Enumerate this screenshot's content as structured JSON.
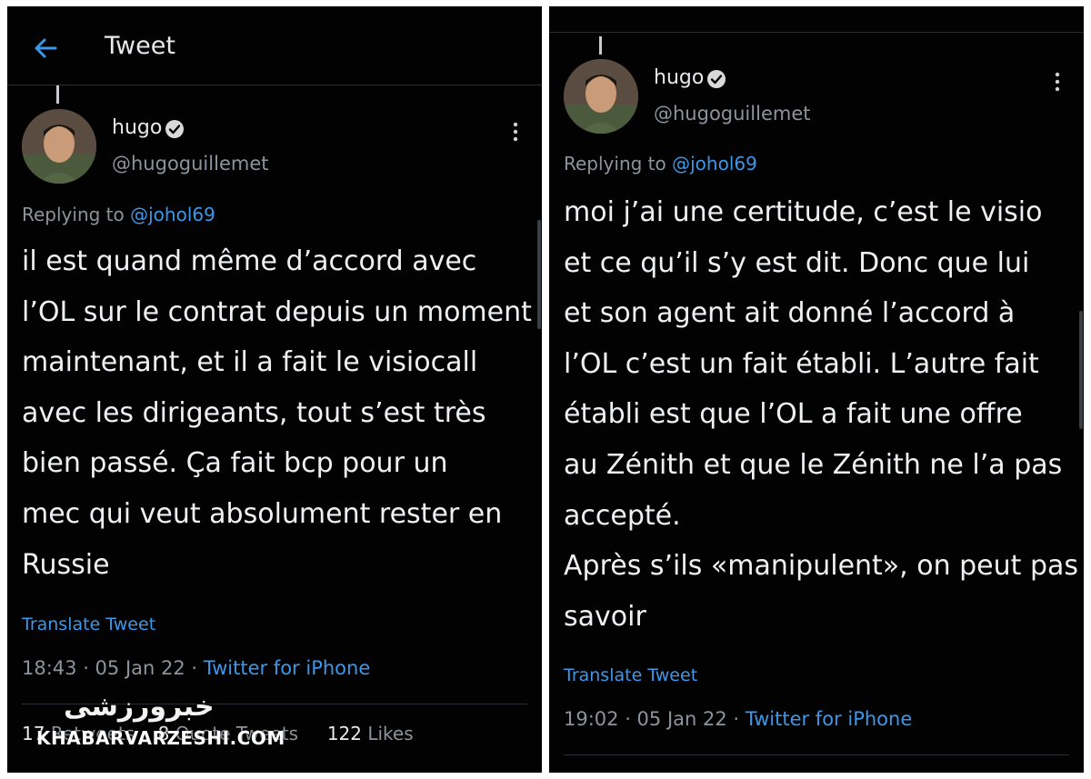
{
  "header": {
    "title": "Tweet"
  },
  "tweets": [
    {
      "user": {
        "name": "hugo",
        "handle": "@hugoguillemet"
      },
      "replying_prefix": "Replying to",
      "replying_to": "@johol69",
      "lines": [
        "il est quand même d’accord avec",
        "l’OL sur le contrat depuis un moment",
        "maintenant, et il a fait le visiocall",
        "avec les dirigeants, tout s’est très",
        "bien passé. Ça fait bcp pour un",
        "mec qui veut absolument rester en",
        "Russie"
      ],
      "translate": "Translate Tweet",
      "time": "18:43 · 05 Jan 22 ·",
      "source": "Twitter for iPhone",
      "stats": {
        "retweets_count": "17",
        "retweets_label": "Retweets",
        "quotes_count": "8",
        "quotes_label": "Quote Tweets",
        "likes_count": "122",
        "likes_label": "Likes"
      }
    },
    {
      "user": {
        "name": "hugo",
        "handle": "@hugoguillemet"
      },
      "replying_prefix": "Replying to",
      "replying_to": "@johol69",
      "lines": [
        "moi j’ai une certitude, c’est le visio",
        "et ce qu’il s’y est dit. Donc que lui",
        "et son agent ait donné l’accord à",
        "l’OL c’est un fait établi. L’autre fait",
        "établi est que l’OL a fait une offre",
        "au Zénith et que le Zénith ne l’a pas",
        "accepté.",
        "Après s’ils «manipulent», on peut pas",
        "savoir"
      ],
      "translate": "Translate Tweet",
      "time": "19:02 · 05 Jan 22 ·",
      "source": "Twitter for iPhone"
    }
  ],
  "watermark": {
    "logo": "خبرورزشی",
    "text": "KHABARVARZESHI.COM"
  },
  "icons": {
    "back": "arrow-left-icon",
    "verified": "verified-badge-icon",
    "more": "vertical-ellipsis-icon"
  },
  "colors": {
    "background": "#020203",
    "link": "#3d97e8",
    "muted": "#8b949c",
    "text": "#e7e9ea"
  }
}
